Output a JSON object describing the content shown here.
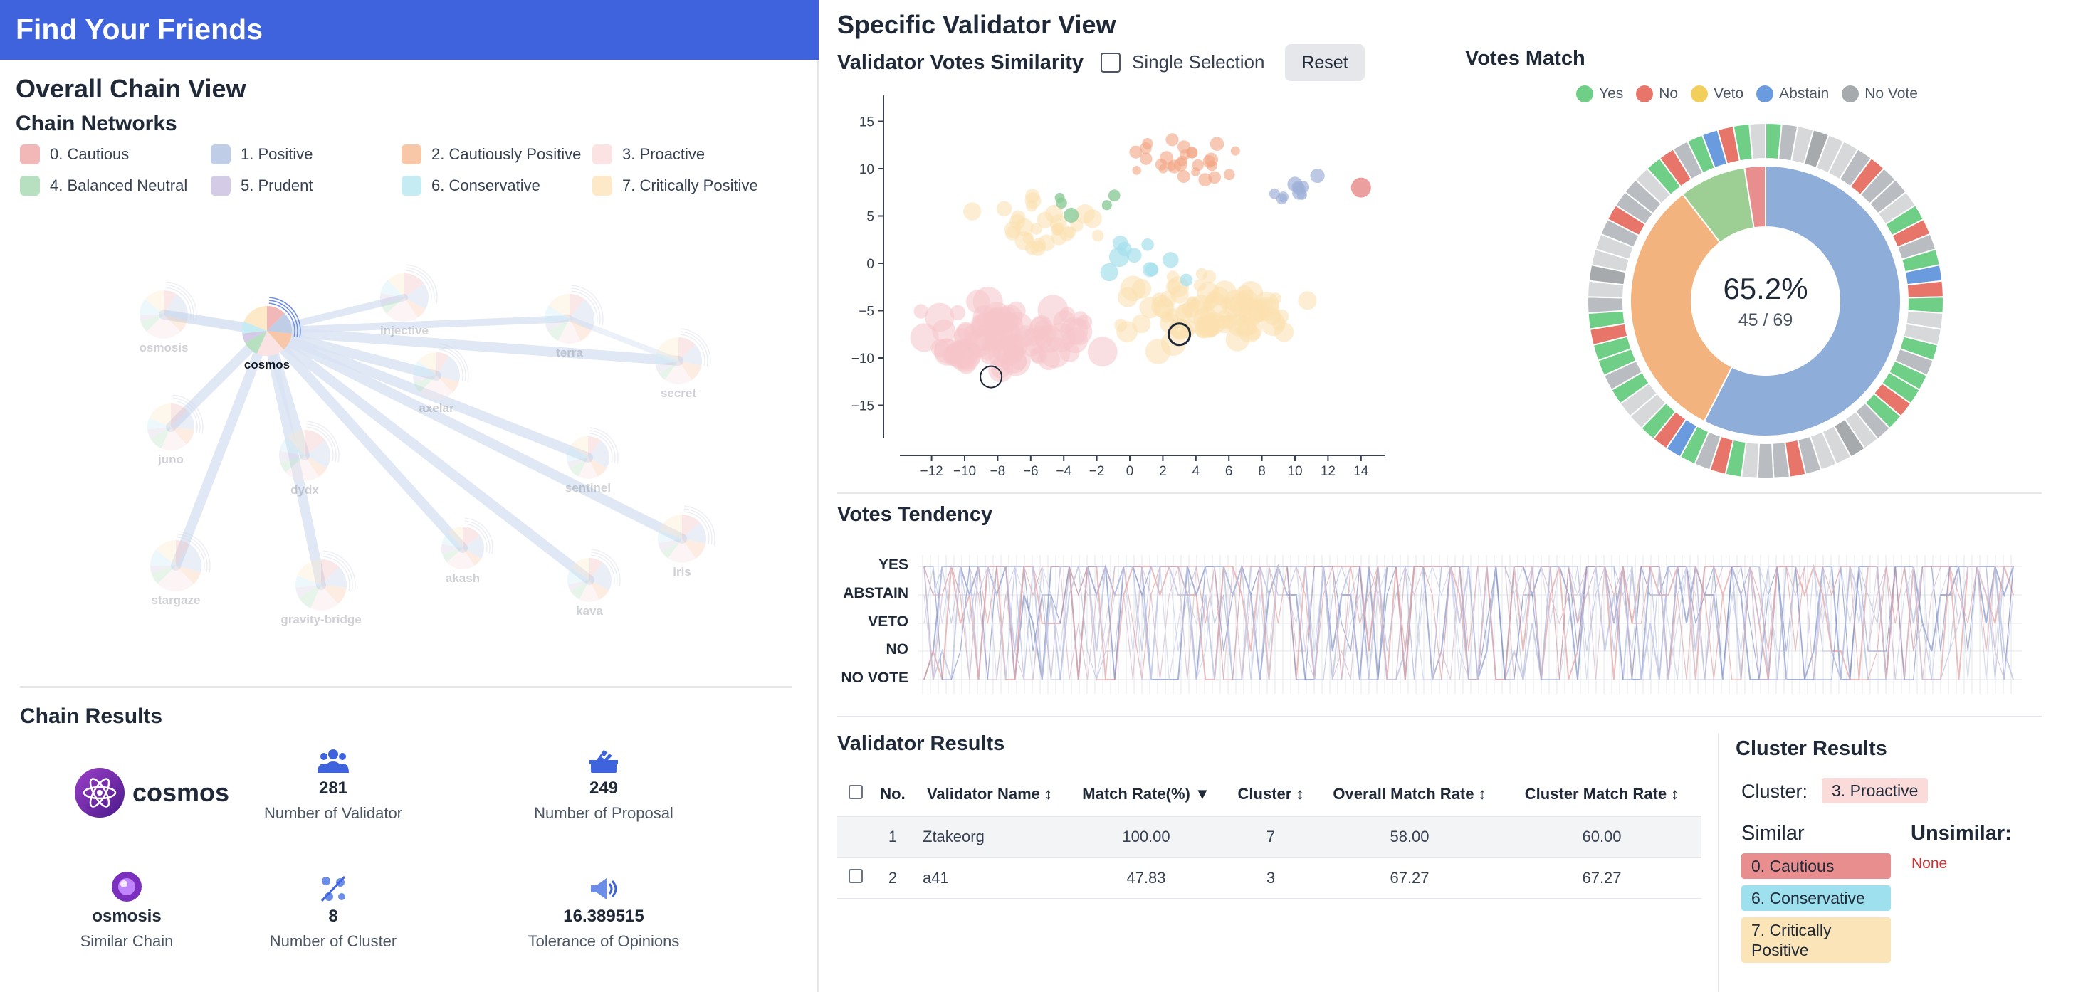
{
  "app": {
    "title": "Find Your Friends"
  },
  "overall": {
    "title": "Overall Chain View",
    "networks_title": "Chain Networks",
    "clusters": [
      {
        "label": "0. Cautious",
        "color": "#f2b8b8"
      },
      {
        "label": "1. Positive",
        "color": "#bfcde6"
      },
      {
        "label": "2. Cautiously Positive",
        "color": "#f7c7a8"
      },
      {
        "label": "3. Proactive",
        "color": "#fbe3e3"
      },
      {
        "label": "4. Balanced Neutral",
        "color": "#b7e0c0"
      },
      {
        "label": "5. Prudent",
        "color": "#d4cbe6"
      },
      {
        "label": "6. Conservative",
        "color": "#c6ecf3"
      },
      {
        "label": "7. Critically Positive",
        "color": "#fde9c7"
      }
    ],
    "network": {
      "center": "cosmos",
      "nodes": [
        "osmosis",
        "cosmos",
        "injective",
        "terra",
        "secret",
        "axelar",
        "juno",
        "dydx",
        "sentinel",
        "iris",
        "stargaze",
        "gravity-bridge",
        "akash",
        "kava"
      ]
    }
  },
  "chain_results": {
    "title": "Chain Results",
    "chain_name": "cosmos",
    "stats": [
      {
        "value": "281",
        "label": "Number of Validator",
        "icon": "users-icon"
      },
      {
        "value": "249",
        "label": "Number of Proposal",
        "icon": "ballot-box-icon"
      },
      {
        "value": "osmosis",
        "label": "Similar Chain",
        "icon": "osmosis-logo"
      },
      {
        "value": "8",
        "label": "Number of Cluster",
        "icon": "cluster-icon"
      },
      {
        "value": "16.389515",
        "label": "Tolerance of Opinions",
        "icon": "megaphone-icon"
      }
    ]
  },
  "validator_view": {
    "title": "Specific Validator View",
    "similarity_title": "Validator Votes Similarity",
    "single_selection_label": "Single Selection",
    "reset_label": "Reset",
    "x_ticks": [
      "−12",
      "−10",
      "−8",
      "−6",
      "−4",
      "−2",
      "0",
      "2",
      "4",
      "6",
      "8",
      "10",
      "12",
      "14"
    ],
    "y_ticks": [
      "15",
      "10",
      "5",
      "0",
      "−5",
      "−10",
      "−15"
    ]
  },
  "votes_match": {
    "title": "Votes Match",
    "legend": [
      {
        "label": "Yes",
        "color": "#6fcf86"
      },
      {
        "label": "No",
        "color": "#e8756a"
      },
      {
        "label": "Veto",
        "color": "#f2cf5b"
      },
      {
        "label": "Abstain",
        "color": "#6b9bdf"
      },
      {
        "label": "No Vote",
        "color": "#a6aaad"
      }
    ],
    "percent": "65.2%",
    "ratio": "45 / 69",
    "chart_data": {
      "type": "pie",
      "title": "Votes Match",
      "match_percent": 65.2,
      "matched": 45,
      "total": 69,
      "inner_ring_share": {
        "Abstain": 0.575,
        "Yes (cautiously positive)": 0.32,
        "Balanced": 0.08,
        "No": 0.025
      }
    }
  },
  "votes_tendency": {
    "title": "Votes Tendency",
    "levels": [
      "YES",
      "ABSTAIN",
      "VETO",
      "NO",
      "NO VOTE"
    ]
  },
  "validator_results": {
    "title": "Validator Results",
    "columns": [
      "No.",
      "Validator Name ↕",
      "Match Rate(%) ▼",
      "Cluster ↕",
      "Overall Match Rate ↕",
      "Cluster Match Rate ↕"
    ],
    "rows": [
      {
        "no": "1",
        "name": "Ztakeorg",
        "match": "100.00",
        "cluster": "7",
        "overall": "58.00",
        "cluster_rate": "60.00"
      },
      {
        "no": "2",
        "name": "a41",
        "match": "47.83",
        "cluster": "3",
        "overall": "67.27",
        "cluster_rate": "67.27"
      }
    ]
  },
  "cluster_results": {
    "title": "Cluster Results",
    "cluster_label": "Cluster:",
    "cluster_value": "3. Proactive",
    "similar_label": "Similar",
    "unsimilar_label": "Unsimilar:",
    "similar": [
      "0. Cautious",
      "6. Conservative",
      "7. Critically Positive"
    ],
    "unsimilar_value": "None",
    "colors": {
      "proactive": "#fbdada",
      "cautious": "#e88e8e",
      "conservative": "#9fe0ee",
      "critically": "#fbe4b7",
      "none": "#cc3333"
    }
  }
}
